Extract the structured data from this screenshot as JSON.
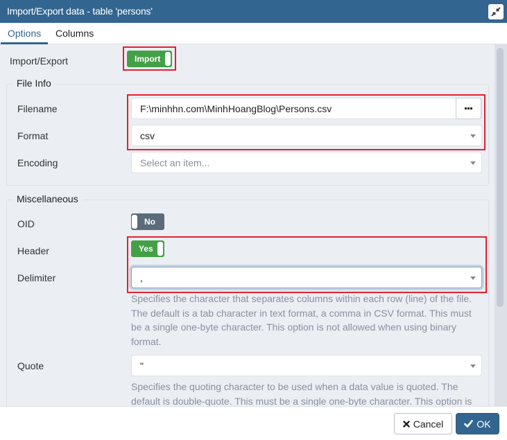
{
  "dialog": {
    "title": "Import/Export data - table 'persons'",
    "restore_icon": "compress-arrows-icon"
  },
  "tabs": [
    {
      "label": "Options",
      "active": true
    },
    {
      "label": "Columns",
      "active": false
    }
  ],
  "import_export": {
    "label": "Import/Export",
    "toggle_value": "Import",
    "toggle_on": true
  },
  "file_info": {
    "legend": "File Info",
    "filename": {
      "label": "Filename",
      "value": "F:\\minhhn.com\\MinhHoangBlog\\Persons.csv",
      "browse_icon": "ellipsis-icon"
    },
    "format": {
      "label": "Format",
      "value": "csv"
    },
    "encoding": {
      "label": "Encoding",
      "placeholder": "Select an item..."
    }
  },
  "misc": {
    "legend": "Miscellaneous",
    "oid": {
      "label": "OID",
      "value": "No",
      "on": false
    },
    "header": {
      "label": "Header",
      "value": "Yes",
      "on": true
    },
    "delimiter": {
      "label": "Delimiter",
      "value": ",",
      "help": "Specifies the character that separates columns within each row (line) of the file. The default is a tab character in text format, a comma in CSV format. This must be a single one-byte character. This option is not allowed when using binary format."
    },
    "quote": {
      "label": "Quote",
      "value": "\"",
      "help": "Specifies the quoting character to be used when a data value is quoted. The default is double-quote. This must be a single one-byte character. This option is not allowed when using binary format."
    }
  },
  "footer": {
    "cancel_label": "Cancel",
    "cancel_icon": "times-icon",
    "ok_label": "OK",
    "ok_icon": "check-icon"
  },
  "colors": {
    "header_bg": "#326690",
    "toggle_on": "#44a047",
    "toggle_off": "#5b6b7c",
    "highlight": "#e5202e",
    "content_bg": "#ebeef3"
  }
}
